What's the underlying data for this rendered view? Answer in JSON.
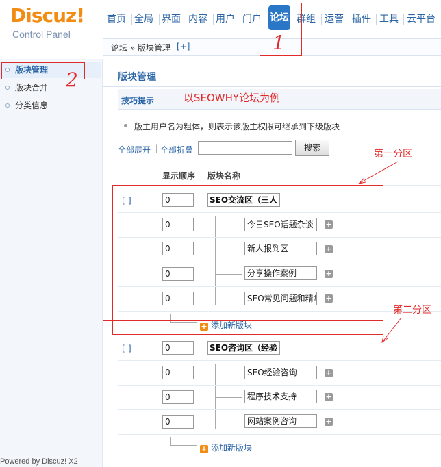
{
  "logo": {
    "main": "Discuz!",
    "sub": "Control Panel"
  },
  "topnav": {
    "items": [
      "首页",
      "全局",
      "界面",
      "内容",
      "用户",
      "门户",
      "论坛",
      "群组",
      "运营",
      "插件",
      "工具",
      "云平台"
    ],
    "active": "论坛"
  },
  "breadcrumb": {
    "path": "论坛 » 版块管理",
    "plus": "[+]"
  },
  "sidebar": {
    "items": [
      "版块管理",
      "版块合并",
      "分类信息"
    ],
    "active": "版块管理"
  },
  "footer": {
    "powered": "Powered by Discuz! X2"
  },
  "main": {
    "title": "版块管理",
    "tip_title": "技巧提示",
    "tip_note": "以SEOWHY论坛为例",
    "tip_text": "版主用户名为粗体，则表示该版主权限可继承到下级版块",
    "expand_all": "全部展开",
    "separator": "|",
    "collapse_all": "全部折叠",
    "search_value": "",
    "search_button": "搜索",
    "col_order": "显示顺序",
    "col_name": "版块名称",
    "add_new": "添加新版块",
    "groups": [
      {
        "toggle": "[-]",
        "order": "0",
        "name": "SEO交流区（三人",
        "forums": [
          {
            "order": "0",
            "name": "今日SEO话题杂谈"
          },
          {
            "order": "0",
            "name": "新人报到区"
          },
          {
            "order": "0",
            "name": "分享操作案例"
          },
          {
            "order": "0",
            "name": "SEO常见问题和精华"
          }
        ]
      },
      {
        "toggle": "[-]",
        "order": "0",
        "name": "SEO咨询区（经验",
        "forums": [
          {
            "order": "0",
            "name": "SEO经验咨询"
          },
          {
            "order": "0",
            "name": "程序技术支持"
          },
          {
            "order": "0",
            "name": "网站案例咨询"
          }
        ]
      }
    ]
  },
  "annotations": {
    "marker_1": "1",
    "marker_2": "2",
    "label_group1": "第一分区",
    "label_group2": "第二分区"
  },
  "colors": {
    "accent": "#2b65a6",
    "annotation": "#e12b2b",
    "brand": "#f28c12"
  }
}
